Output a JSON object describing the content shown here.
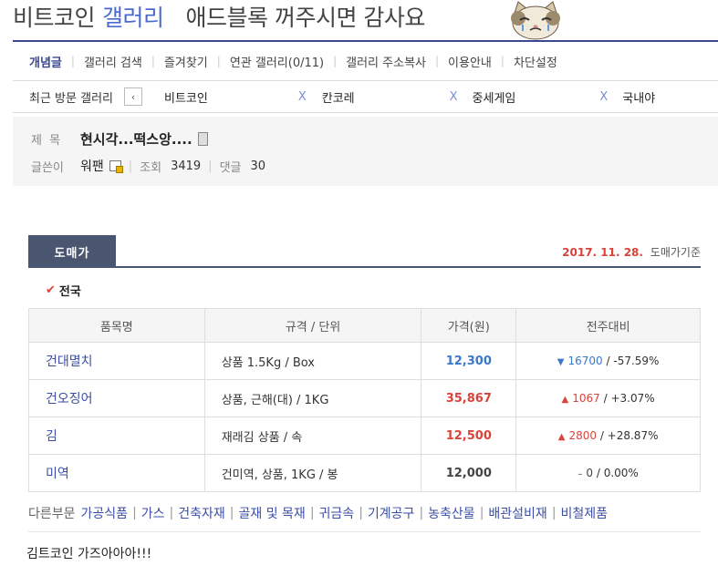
{
  "header": {
    "gallery_name": "비트코인",
    "gallery_word": "갤러리",
    "banner_text": "애드블록 꺼주시면 감사요"
  },
  "nav": {
    "items": [
      {
        "label": "개념글",
        "active": true
      },
      {
        "label": "갤러리 검색"
      },
      {
        "label": "즐겨찾기"
      },
      {
        "label": "연관 갤러리(0/11)"
      },
      {
        "label": "갤러리 주소복사"
      },
      {
        "label": "이용안내"
      },
      {
        "label": "차단설정"
      }
    ]
  },
  "recent": {
    "label": "최근 방문 갤러리",
    "prev_icon": "‹",
    "close_glyph": "X",
    "galleries": [
      "비트코인",
      "칸코레",
      "중세게임",
      "국내야"
    ]
  },
  "post": {
    "subject_label": "제 목",
    "subject": "현시각...떡스앙....",
    "writer_label": "글쓴이",
    "writer": "워팬",
    "views_label": "조회",
    "views": "3419",
    "comments_label": "댓글",
    "comments": "30"
  },
  "price_widget": {
    "tab_label": "도매가",
    "date": "2017. 11. 28.",
    "date_suffix": "도매가기준",
    "check_glyph": "✔",
    "region": "전국",
    "columns": [
      "품목명",
      "규격 / 단위",
      "가격(원)",
      "전주대비"
    ],
    "rows": [
      {
        "item": "건대멸치",
        "spec": "상품 1.5Kg / Box",
        "price": "12,300",
        "arrow": "▼",
        "change": "16700",
        "percent": "/ -57.59%",
        "color": "#3a78c9"
      },
      {
        "item": "건오징어",
        "spec": "상품, 근해(대) / 1KG",
        "price": "35,867",
        "arrow": "▲",
        "change": "1067",
        "percent": "/ +3.07%",
        "color": "#d9433a"
      },
      {
        "item": "김",
        "spec": "재래김 상품 / 속",
        "price": "12,500",
        "arrow": "▲",
        "change": "2800",
        "percent": "/ +28.87%",
        "color": "#d9433a"
      },
      {
        "item": "미역",
        "spec": "건미역, 상품, 1KG / 봉",
        "price": "12,000",
        "arrow": "–",
        "change": "0",
        "percent": "/ 0.00%",
        "color": "#444444"
      }
    ],
    "other_label": "다른부문",
    "other_categories": [
      "가공식품",
      "가스",
      "건축자재",
      "골재 및 목재",
      "귀금속",
      "기계공구",
      "농축산물",
      "배관설비재",
      "비철제품"
    ]
  },
  "content": {
    "body": "김트코인 가즈아아아!!!"
  }
}
